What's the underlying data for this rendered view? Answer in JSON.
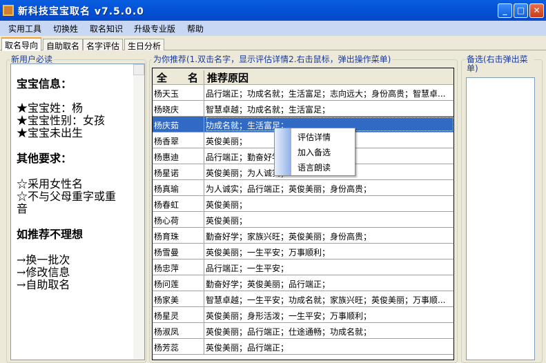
{
  "window": {
    "title": "新科技宝宝取名 v7.5.0.0",
    "minimize": "_",
    "maximize": "□",
    "close": "✕"
  },
  "menu": [
    "实用工具",
    "切换姓",
    "取名知识",
    "升级专业版",
    "帮助"
  ],
  "tabs": [
    "取名导向",
    "自助取名",
    "名字评估",
    "生日分析"
  ],
  "left": {
    "group_title": "新用户必读",
    "lines": [
      "宝宝信息：",
      "★宝宝姓：杨",
      "★宝宝性别：女孩",
      "★宝宝未出生",
      "其他要求：",
      "☆采用女性名",
      "☆不与父母重字或重",
      "音",
      "如推荐不理想",
      "→换一批次",
      "→修改信息",
      "→自助取名"
    ]
  },
  "recommend": {
    "group_title": "为你推荐(1.双击名字，显示评估详情2.右击鼠标，弹出操作菜单)",
    "col_name": "全　　名",
    "col_reason": "推荐原因",
    "selected_index": 2,
    "rows": [
      {
        "name": "杨天玉",
        "reason": "品行端正；功成名就；生活富足；志向远大；身份高贵；智慧卓..."
      },
      {
        "name": "杨晓庆",
        "reason": "智慧卓越；功成名就；生活富足；"
      },
      {
        "name": "杨庆茹",
        "reason": "功成名就；生活富足；"
      },
      {
        "name": "杨香翠",
        "reason": "英俊美丽；"
      },
      {
        "name": "杨惠迪",
        "reason": "品行端正；勤奋好学；"
      },
      {
        "name": "杨星诺",
        "reason": "英俊美丽；为人诚实；"
      },
      {
        "name": "杨真瑜",
        "reason": "为人诚实；品行端正；英俊美丽；身份高贵；"
      },
      {
        "name": "杨春虹",
        "reason": "英俊美丽；"
      },
      {
        "name": "杨心荷",
        "reason": "英俊美丽；"
      },
      {
        "name": "杨育珠",
        "reason": "勤奋好学；家族兴旺；英俊美丽；身份高贵；"
      },
      {
        "name": "杨雪曼",
        "reason": "英俊美丽；一生平安；万事顺利；"
      },
      {
        "name": "杨忠萍",
        "reason": "品行端正；一生平安；"
      },
      {
        "name": "杨问莲",
        "reason": "勤奋好学；英俊美丽；品行端正；"
      },
      {
        "name": "杨家美",
        "reason": "智慧卓越；一生平安；功成名就；家族兴旺；英俊美丽；万事顺..."
      },
      {
        "name": "杨星灵",
        "reason": "英俊美丽；身形活泼；一生平安；万事顺利；"
      },
      {
        "name": "杨淑凤",
        "reason": "英俊美丽；品行端正；仕途通畅；功成名就；"
      },
      {
        "name": "杨芳蕊",
        "reason": "英俊美丽；品行端正；"
      }
    ]
  },
  "context_menu": [
    "评估详情",
    "加入备选",
    "语言朗读"
  ],
  "right": {
    "group_title": "备选(右击弹出菜单)"
  }
}
